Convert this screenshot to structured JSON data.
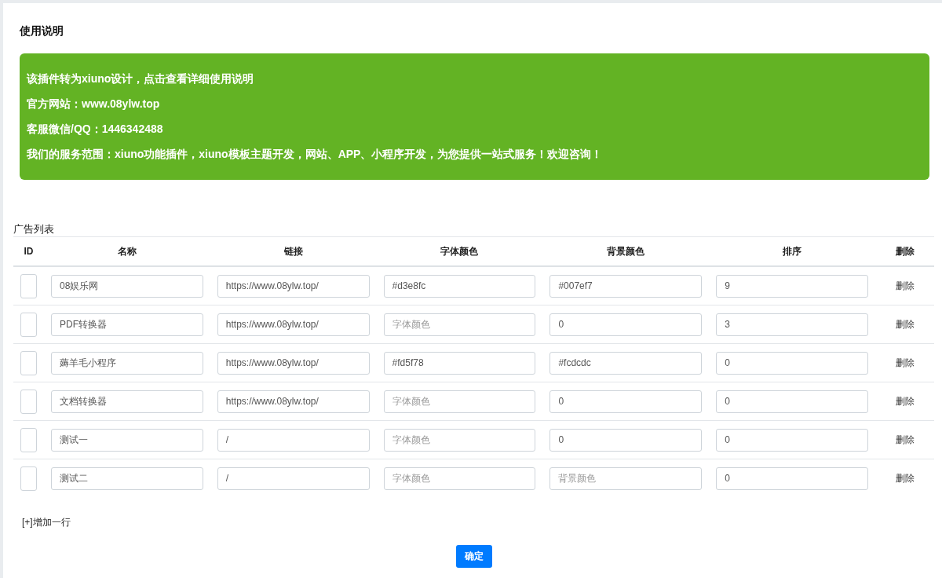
{
  "heading": "使用说明",
  "notice": [
    "该插件转为xiuno设计，点击查看详细使用说明",
    "官方网站：www.08ylw.top",
    "客服微信/QQ：1446342488",
    "我们的服务范围：xiuno功能插件，xiuno模板主题开发，网站、APP、小程序开发，为您提供一站式服务！欢迎咨询！"
  ],
  "table": {
    "caption": "广告列表",
    "columns": [
      "ID",
      "名称",
      "链接",
      "字体颜色",
      "背景颜色",
      "排序",
      "删除"
    ],
    "rows": [
      {
        "cells": [
          {},
          {
            "value": "08娱乐网"
          },
          {
            "value": "https://www.08ylw.top/"
          },
          {
            "value": "#d3e8fc"
          },
          {
            "value": "#007ef7"
          },
          {
            "value": "9"
          }
        ],
        "delete": "删除"
      },
      {
        "cells": [
          {},
          {
            "value": "PDF转换器"
          },
          {
            "value": "https://www.08ylw.top/"
          },
          {
            "placeholder": "字体颜色"
          },
          {
            "value": "0"
          },
          {
            "value": "3"
          }
        ],
        "delete": "删除"
      },
      {
        "cells": [
          {},
          {
            "value": "薅羊毛小程序"
          },
          {
            "value": "https://www.08ylw.top/"
          },
          {
            "value": "#fd5f78"
          },
          {
            "value": "#fcdcdc"
          },
          {
            "value": "0"
          }
        ],
        "delete": "删除"
      },
      {
        "cells": [
          {},
          {
            "value": "文档转换器"
          },
          {
            "value": "https://www.08ylw.top/"
          },
          {
            "placeholder": "字体颜色"
          },
          {
            "value": "0"
          },
          {
            "value": "0"
          }
        ],
        "delete": "删除"
      },
      {
        "cells": [
          {},
          {
            "value": "测试一"
          },
          {
            "value": "/"
          },
          {
            "placeholder": "字体颜色"
          },
          {
            "value": "0"
          },
          {
            "value": "0"
          }
        ],
        "delete": "删除"
      },
      {
        "cells": [
          {},
          {
            "value": "测试二"
          },
          {
            "value": "/"
          },
          {
            "placeholder": "字体颜色"
          },
          {
            "placeholder": "背景颜色"
          },
          {
            "value": "0"
          }
        ],
        "delete": "删除"
      }
    ]
  },
  "add_row": "[+]增加一行",
  "submit": "确定"
}
